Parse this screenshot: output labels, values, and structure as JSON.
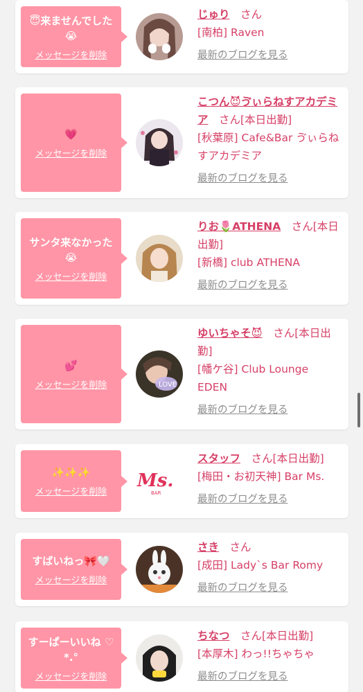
{
  "delete_label": "メッセージを削除",
  "blog_label": "最新のブログを見る",
  "san_label": "さん",
  "cards": [
    {
      "message": "😇来ませんでした😭",
      "name": "じゅり",
      "suffix": "",
      "store": "[南柏] Raven"
    },
    {
      "message": "💗",
      "name": "こつん😈ゔぃらねすアカデミア",
      "suffix": "[本日出勤]",
      "store": "[秋葉原] Cafe&Bar ゔぃらねすアカデミア"
    },
    {
      "message": "サンタ来なかった😭",
      "name": "りお🌷ATHENA",
      "suffix": "[本日出勤]",
      "store": "[新橋] club ATHENA"
    },
    {
      "message": "💕",
      "name": "ゆいちゃそ😈",
      "suffix": "[本日出勤]",
      "store": "[幡ケ谷] Club Lounge EDEN"
    },
    {
      "message": "✨✨✨",
      "name": "スタッフ",
      "suffix": "[本日出勤]",
      "store": "[梅田・お初天神] Bar Ms."
    },
    {
      "message": "すばいねっ🎀🤍",
      "name": "さき",
      "suffix": "",
      "store": "[成田] Lady`s Bar Romy"
    },
    {
      "message": "すーぱーいいね ♡*.°",
      "name": "ちなつ",
      "suffix": "[本日出勤]",
      "store": "[本厚木] わっ!!ちゃちゃ"
    }
  ],
  "logo_text": "Ms.",
  "logo_sub": "BAR"
}
